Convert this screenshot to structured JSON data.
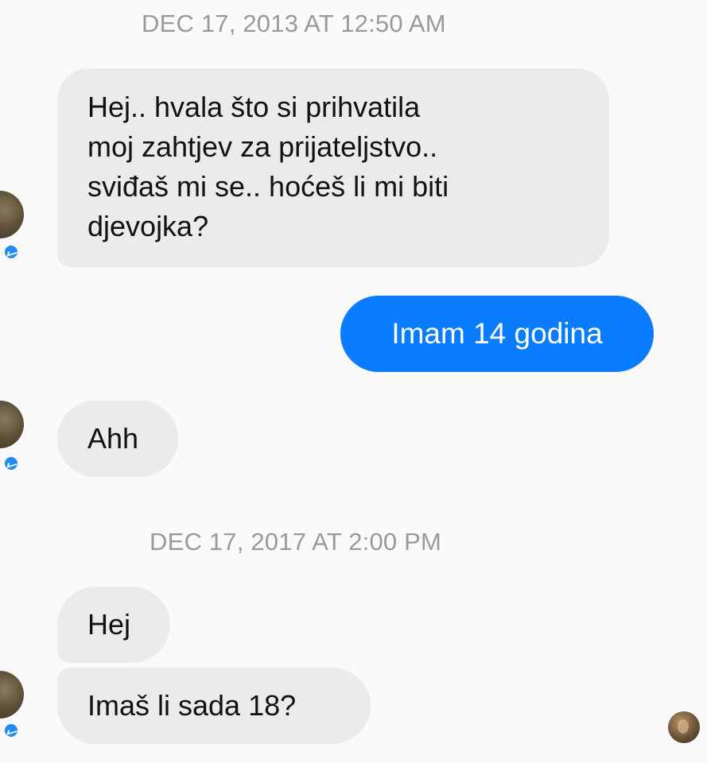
{
  "conversation": {
    "timestamps": [
      "DEC 17, 2013 AT 12:50 AM",
      "DEC 17, 2017 AT 2:00 PM"
    ],
    "messages": [
      {
        "sender": "other",
        "text": "Hej.. hvala što si prihvatila\nmoj zahtjev za prijateljstvo..\nsviđaš mi se.. hoćeš li mi biti\ndjevojka?"
      },
      {
        "sender": "me",
        "text": "Imam 14 godina"
      },
      {
        "sender": "other",
        "text": "Ahh"
      },
      {
        "sender": "other",
        "text": "Hej"
      },
      {
        "sender": "other",
        "text": "Imaš li sada 18?"
      }
    ]
  },
  "colors": {
    "incoming_bubble": "#ebebeb",
    "outgoing_bubble": "#0a7cff",
    "timestamp_text": "#9a9a9a",
    "messenger_badge": "#1e8cf0"
  },
  "icons": {
    "badge": "messenger-badge-icon",
    "contact_avatar": "contact-avatar",
    "seen_indicator": "seen-avatar"
  }
}
